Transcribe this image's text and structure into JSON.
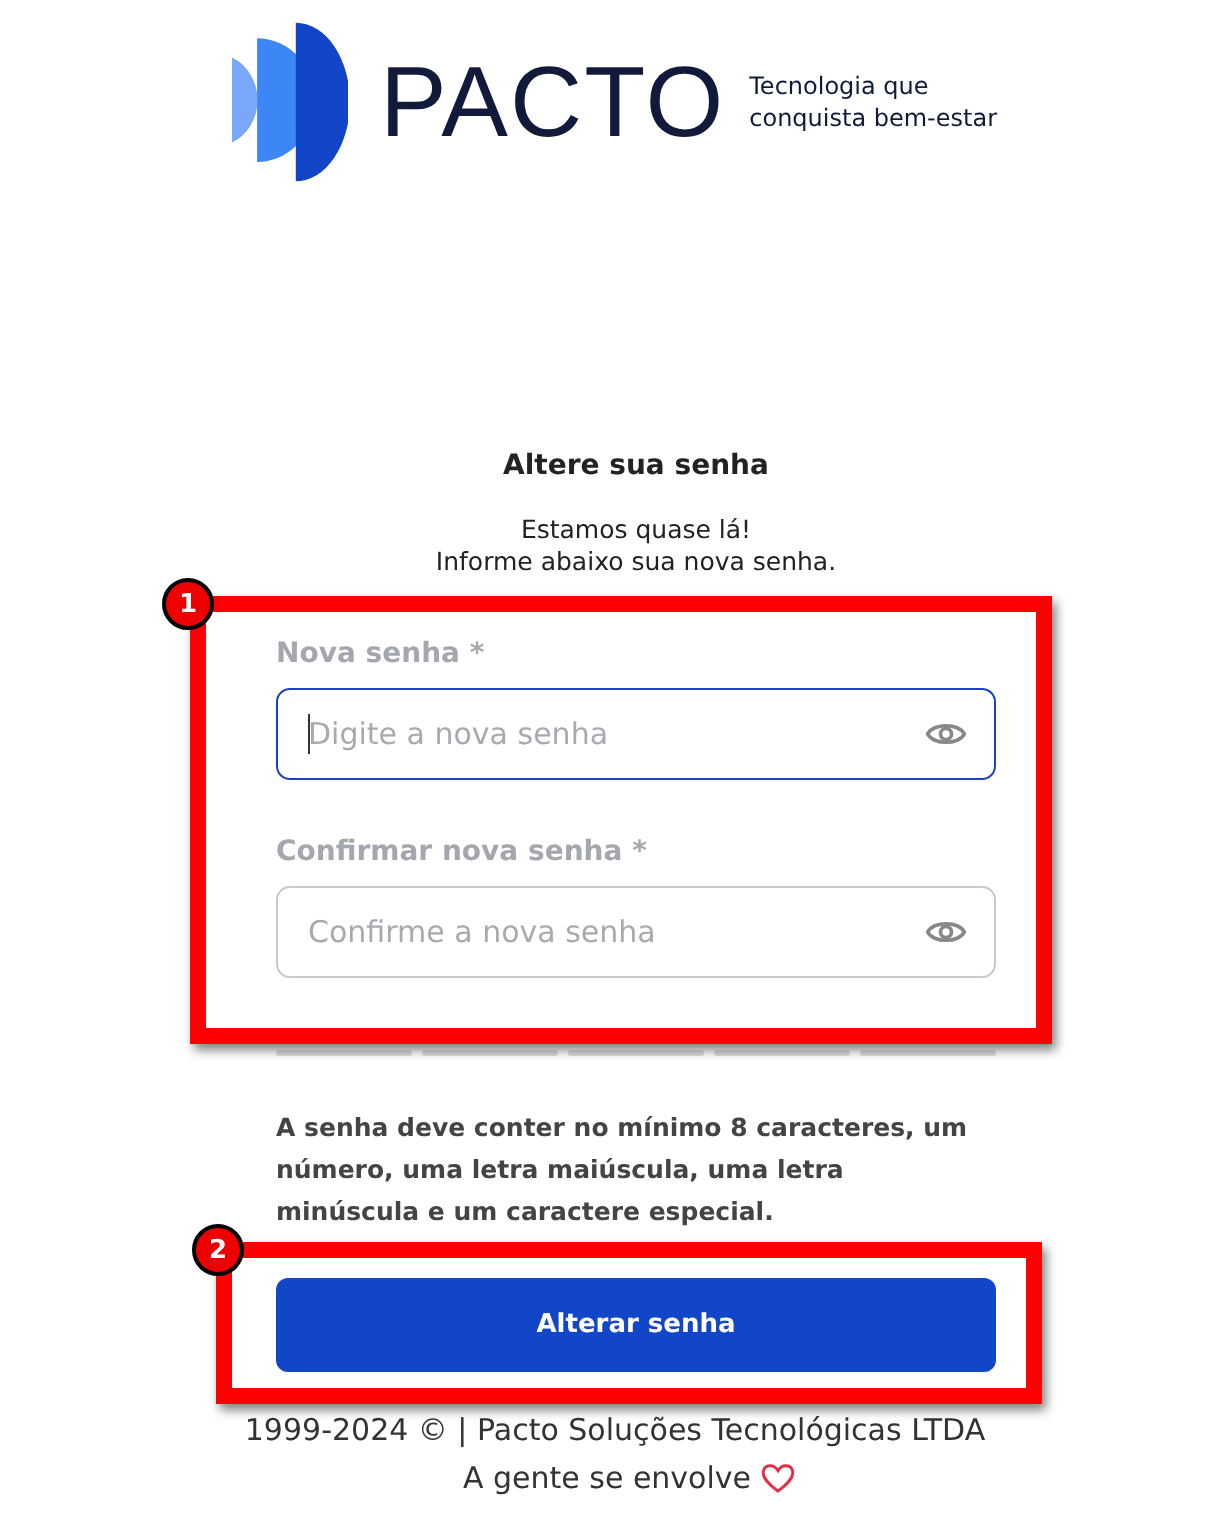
{
  "logo": {
    "wordmark": "PACTO",
    "tagline_lines": [
      "Tecnologia que",
      "conquista bem-estar"
    ]
  },
  "heading": "Altere sua senha",
  "subtitle_lines": [
    "Estamos quase lá!",
    "Informe abaixo sua nova senha."
  ],
  "fields": [
    {
      "label": "Nova senha *",
      "placeholder": "Digite a nova senha",
      "focused": true
    },
    {
      "label": "Confirmar nova senha *",
      "placeholder": "Confirme a nova senha",
      "focused": false
    }
  ],
  "requirements": "A senha deve conter no mínimo 8 caracteres, um número, uma letra maiúscula, uma letra minúscula e um caractere especial.",
  "submit_button": "Alterar senha",
  "footer": {
    "copyright": "1999-2024 © | Pacto Soluções Tecnológicas LTDA",
    "slogan": "A gente se envolve"
  },
  "annotations": [
    {
      "number": "1"
    },
    {
      "number": "2"
    }
  ]
}
